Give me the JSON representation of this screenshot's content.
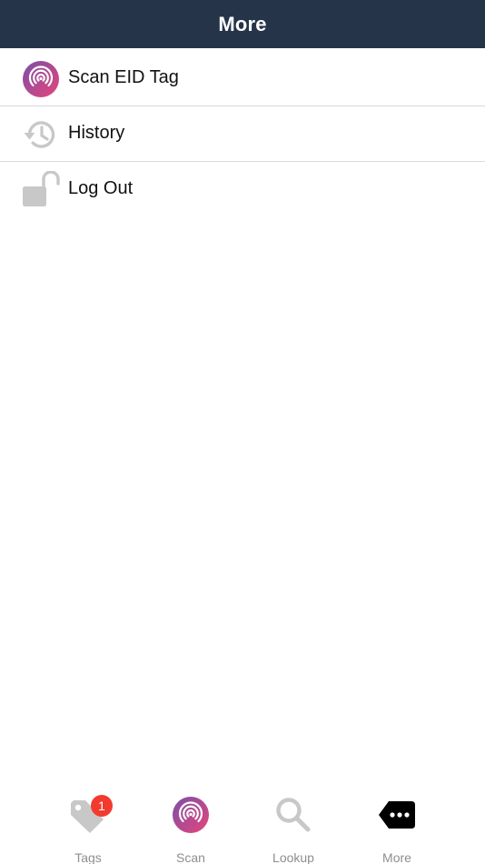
{
  "header": {
    "title": "More"
  },
  "menu": {
    "items": [
      {
        "label": "Scan EID Tag",
        "icon": "scan-radio-icon"
      },
      {
        "label": "History",
        "icon": "history-clock-icon"
      },
      {
        "label": "Log Out",
        "icon": "unlocked-padlock-icon"
      }
    ]
  },
  "tabbar": {
    "tabs": [
      {
        "label": "Tags",
        "icon": "tag-icon",
        "badge": "1"
      },
      {
        "label": "Scan",
        "icon": "scan-radio-icon"
      },
      {
        "label": "Lookup",
        "icon": "magnifier-icon"
      },
      {
        "label": "More",
        "icon": "more-ellipsis-tag-icon",
        "selected": true
      }
    ]
  },
  "colors": {
    "nav_background": "#253449",
    "accent_gradient_start": "#7b4fa8",
    "accent_gradient_end": "#e6457a",
    "inactive_icon": "#c8c8c8",
    "tab_label": "#8e8e93",
    "badge": "#f23b2e"
  }
}
